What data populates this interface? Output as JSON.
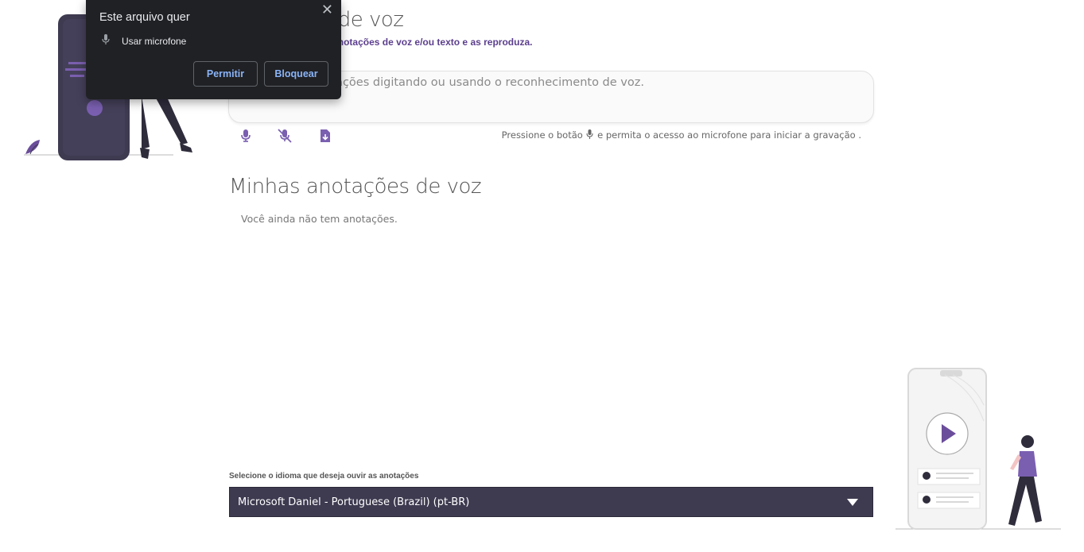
{
  "header": {
    "title": "Nova nota de voz",
    "subtitle": "Permite que você faça anotações de voz e/ou texto e as reproduza."
  },
  "editor": {
    "placeholder": "Digite suas anotações digitando ou usando o reconhecimento de voz."
  },
  "toolbar": {
    "icons": [
      "microphone-icon",
      "microphone-off-icon",
      "save-download-icon"
    ]
  },
  "hint": {
    "before": "Pressione o botão",
    "after": "e permita o acesso ao microfone para iniciar a gravação ."
  },
  "notes": {
    "title": "Minhas anotações de voz",
    "empty_message": "Você ainda não tem anotações."
  },
  "language": {
    "label": "Selecione o idioma que deseja ouvir as anotações",
    "selected": "Microsoft Daniel - Portuguese (Brazil) (pt-BR)"
  },
  "permission_popup": {
    "title": "Este arquivo quer",
    "item": "Usar microfone",
    "allow_label": "Permitir",
    "block_label": "Bloquear",
    "close_symbol": "✕"
  },
  "colors": {
    "accent": "#5c3f8e",
    "dark": "#3e3a50",
    "popup_bg": "#202124",
    "popup_link": "#8ab4f8"
  }
}
